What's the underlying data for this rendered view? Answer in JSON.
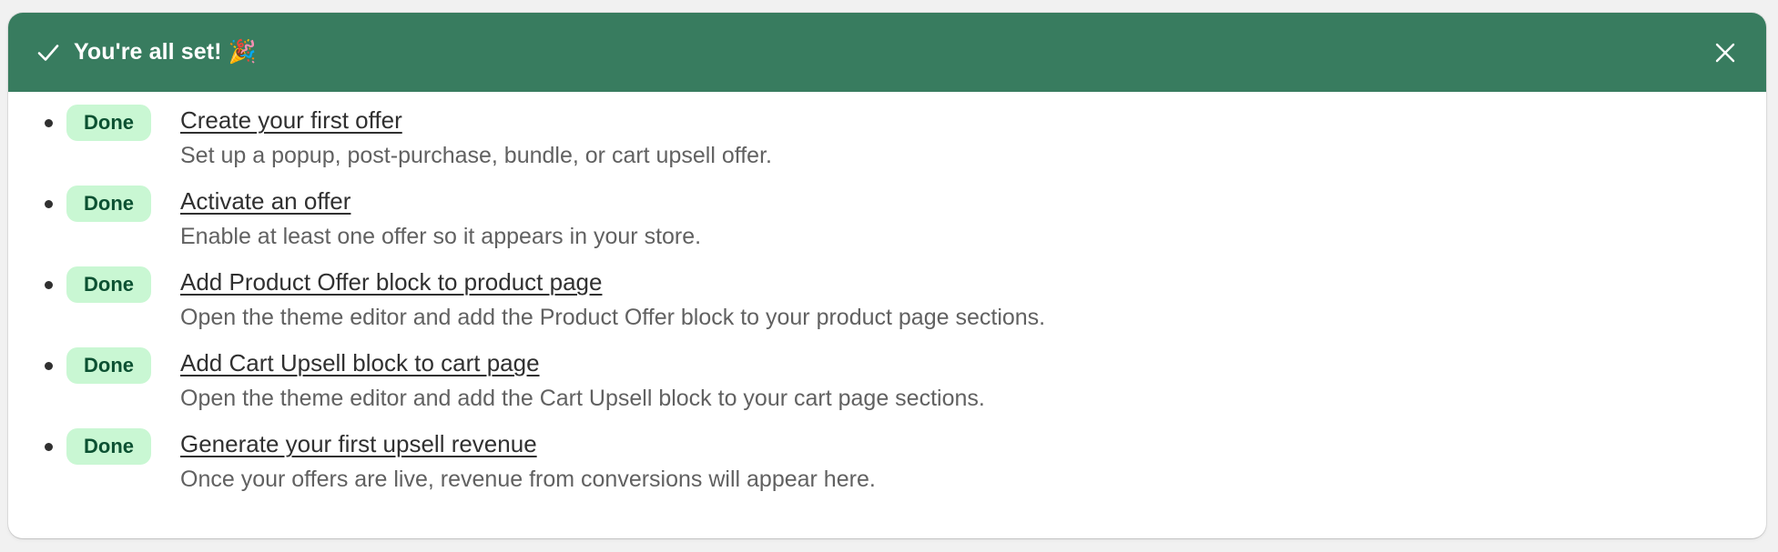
{
  "banner": {
    "title": "You're all set! 🎉",
    "check_icon": "checkmark-icon",
    "close_icon": "close-icon",
    "background_color": "#387c5f"
  },
  "badge_color": "#c9f7d3",
  "badge_text_color": "#0c5132",
  "tasks": [
    {
      "status": "Done",
      "title": "Create your first offer",
      "description": "Set up a popup, post-purchase, bundle, or cart upsell offer."
    },
    {
      "status": "Done",
      "title": "Activate an offer",
      "description": "Enable at least one offer so it appears in your store."
    },
    {
      "status": "Done",
      "title": "Add Product Offer block to product page",
      "description": "Open the theme editor and add the Product Offer block to your product page sections."
    },
    {
      "status": "Done",
      "title": "Add Cart Upsell block to cart page",
      "description": "Open the theme editor and add the Cart Upsell block to your cart page sections."
    },
    {
      "status": "Done",
      "title": "Generate your first upsell revenue",
      "description": "Once your offers are live, revenue from conversions will appear here."
    }
  ]
}
